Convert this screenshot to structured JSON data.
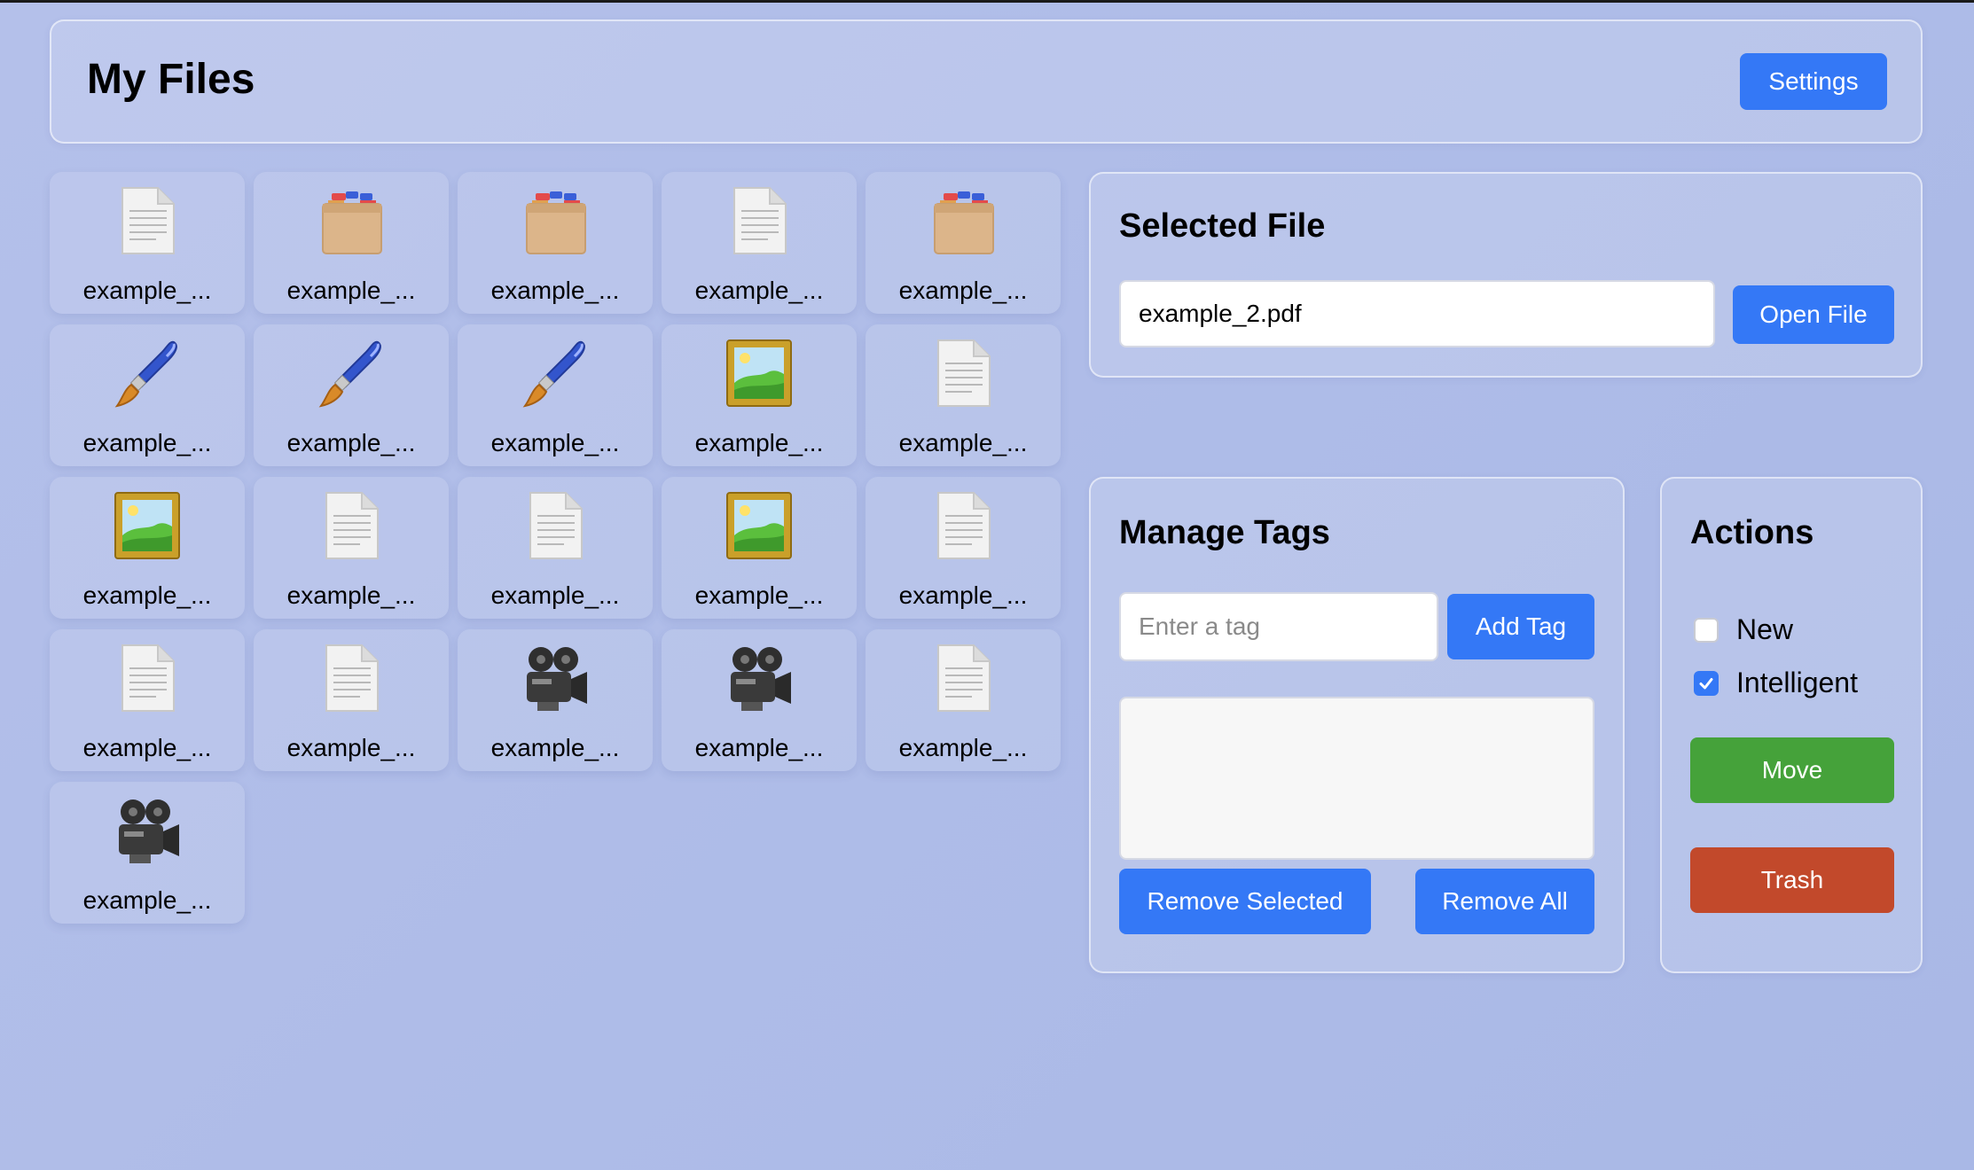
{
  "header": {
    "title": "My Files",
    "settings_label": "Settings"
  },
  "files": [
    {
      "name": "example_...",
      "icon": "document-icon"
    },
    {
      "name": "example_...",
      "icon": "file-cabinet-icon"
    },
    {
      "name": "example_...",
      "icon": "file-cabinet-icon"
    },
    {
      "name": "example_...",
      "icon": "document-icon"
    },
    {
      "name": "example_...",
      "icon": "file-cabinet-icon"
    },
    {
      "name": "example_...",
      "icon": "paintbrush-icon"
    },
    {
      "name": "example_...",
      "icon": "paintbrush-icon"
    },
    {
      "name": "example_...",
      "icon": "paintbrush-icon"
    },
    {
      "name": "example_...",
      "icon": "framed-picture-icon"
    },
    {
      "name": "example_...",
      "icon": "document-icon"
    },
    {
      "name": "example_...",
      "icon": "framed-picture-icon"
    },
    {
      "name": "example_...",
      "icon": "document-icon"
    },
    {
      "name": "example_...",
      "icon": "document-icon"
    },
    {
      "name": "example_...",
      "icon": "framed-picture-icon"
    },
    {
      "name": "example_...",
      "icon": "document-icon"
    },
    {
      "name": "example_...",
      "icon": "document-icon"
    },
    {
      "name": "example_...",
      "icon": "document-icon"
    },
    {
      "name": "example_...",
      "icon": "movie-camera-icon"
    },
    {
      "name": "example_...",
      "icon": "movie-camera-icon"
    },
    {
      "name": "example_...",
      "icon": "document-icon"
    },
    {
      "name": "example_...",
      "icon": "movie-camera-icon"
    }
  ],
  "selected_file": {
    "title": "Selected File",
    "value": "example_2.pdf",
    "open_label": "Open File"
  },
  "manage_tags": {
    "title": "Manage Tags",
    "input_placeholder": "Enter a tag",
    "add_label": "Add Tag",
    "tags": [],
    "remove_selected_label": "Remove Selected",
    "remove_all_label": "Remove All"
  },
  "actions": {
    "title": "Actions",
    "options": [
      {
        "label": "New",
        "checked": false
      },
      {
        "label": "Intelligent",
        "checked": true
      }
    ],
    "move_label": "Move",
    "trash_label": "Trash"
  },
  "colors": {
    "accent": "#3478f6",
    "move": "#45a23a",
    "trash": "#c2492b",
    "background": "#b0bde8"
  }
}
